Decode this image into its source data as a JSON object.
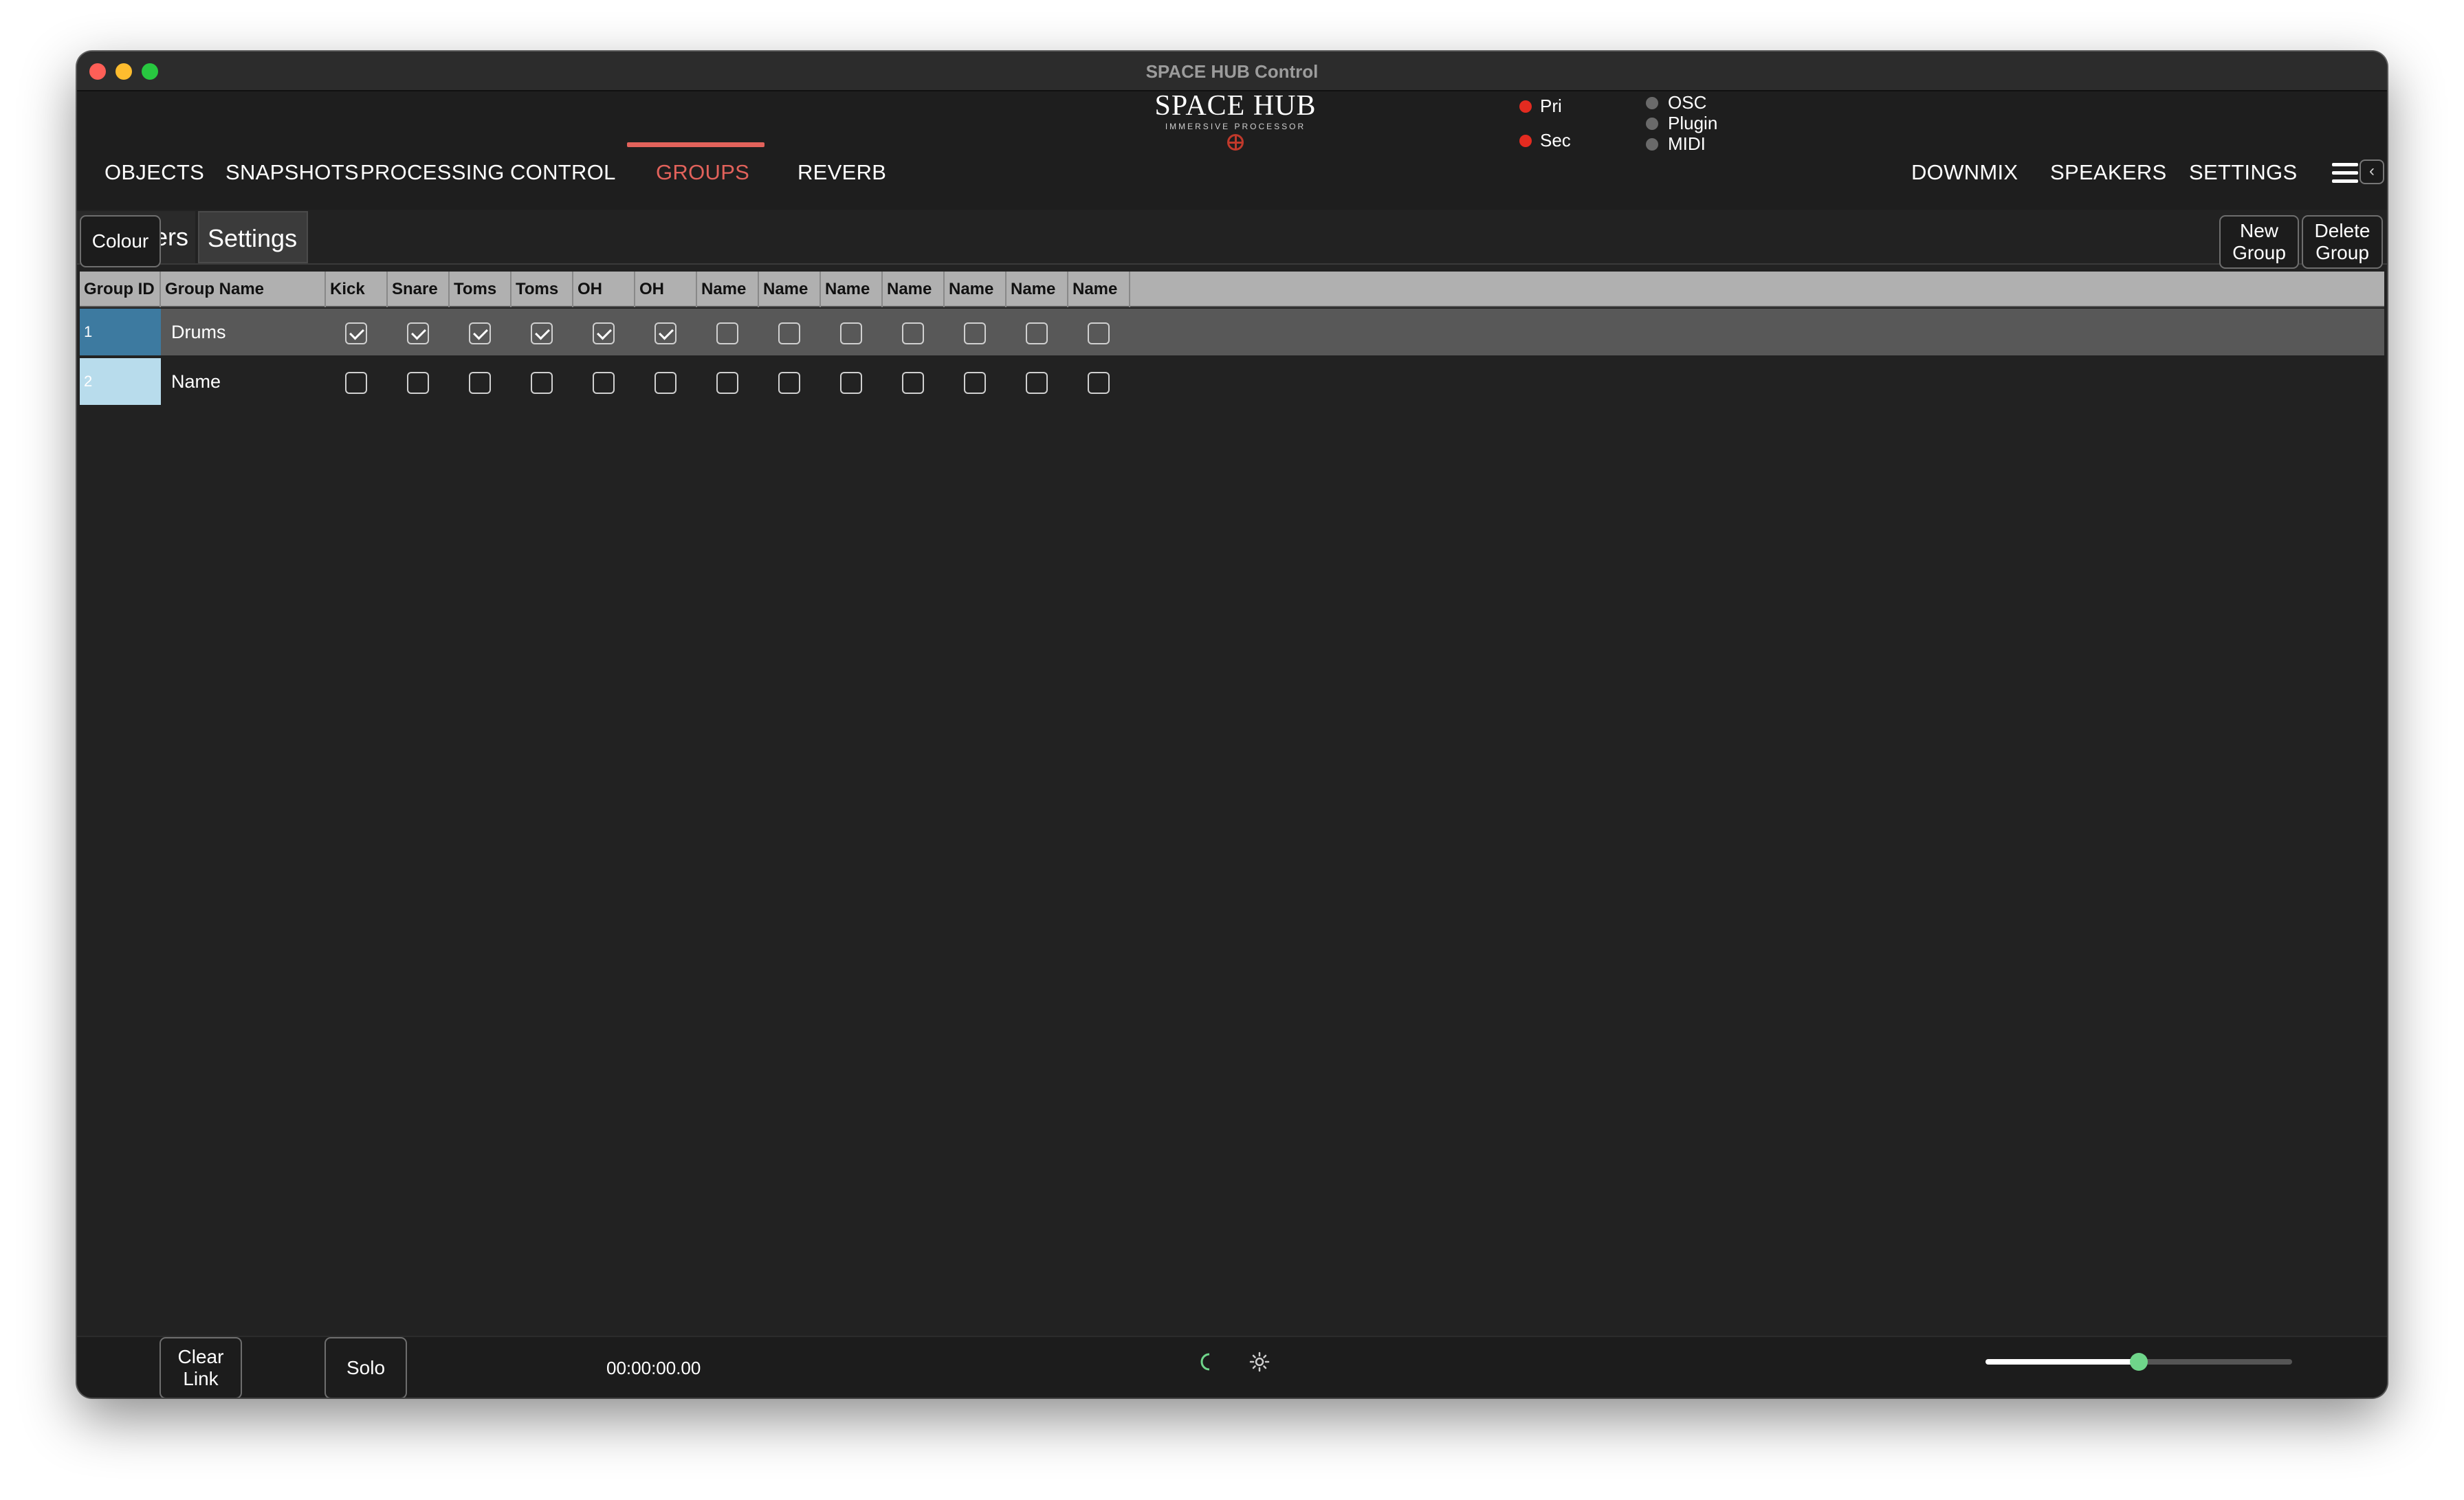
{
  "window": {
    "title": "SPACE HUB Control"
  },
  "nav": {
    "left": [
      "OBJECTS",
      "SNAPSHOTS",
      "PROCESSING",
      "CONTROL",
      "GROUPS",
      "REVERB"
    ],
    "right": [
      "DOWNMIX",
      "SPEAKERS",
      "SETTINGS"
    ],
    "active": "GROUPS"
  },
  "logo": {
    "title": "SPACE HUB",
    "subtitle": "IMMERSIVE PROCESSOR"
  },
  "status": {
    "pri": "Pri",
    "sec": "Sec",
    "osc": "OSC",
    "plugin": "Plugin",
    "midi": "MIDI"
  },
  "colors": {
    "accent": "#e2625b",
    "status_red": "#e32b20",
    "status_grey": "#6a6a6a",
    "slider_thumb": "#6fd58a"
  },
  "subtabs": {
    "members": "Members",
    "settings": "Settings"
  },
  "toolbar": {
    "colour": "Colour",
    "new_group_1": "New",
    "new_group_2": "Group",
    "delete_group_1": "Delete",
    "delete_group_2": "Group"
  },
  "table": {
    "headers": [
      "Group ID",
      "Group Name",
      "Kick",
      "Snare",
      "Toms",
      "Toms",
      "OH",
      "OH",
      "Name",
      "Name",
      "Name",
      "Name",
      "Name",
      "Name",
      "Name"
    ],
    "rows": [
      {
        "id": "1",
        "name": "Drums",
        "color": "#3d7aa0",
        "checks": [
          true,
          true,
          true,
          true,
          true,
          true,
          false,
          false,
          false,
          false,
          false,
          false,
          false
        ]
      },
      {
        "id": "2",
        "name": "Name",
        "color": "#b8dcec",
        "checks": [
          false,
          false,
          false,
          false,
          false,
          false,
          false,
          false,
          false,
          false,
          false,
          false,
          false
        ]
      }
    ]
  },
  "bottom": {
    "clear_1": "Clear",
    "clear_2": "Link",
    "solo": "Solo",
    "timecode": "00:00:00.00",
    "volume": 0.5
  }
}
